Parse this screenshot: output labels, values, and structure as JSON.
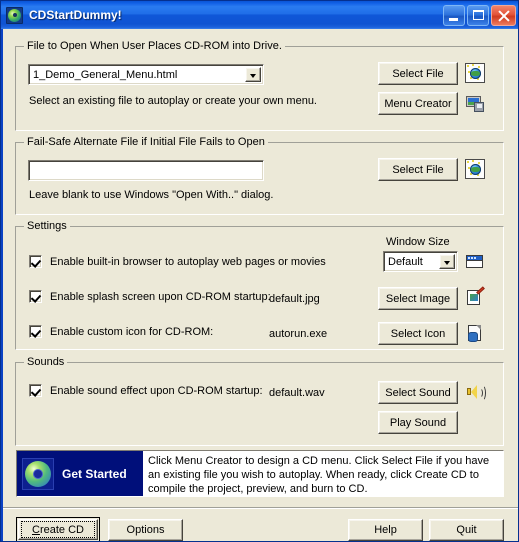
{
  "window": {
    "title": "CDStartDummy!",
    "app_icon": "cd-disc-icon",
    "controls": {
      "minimize": "minimize-button",
      "maximize": "maximize-button",
      "close": "close-button"
    },
    "colors": {
      "titlebar_blue": "#1261e6",
      "client_background": "#ece9d8",
      "close_red": "#e3543a",
      "panel_navy": "#000f7a"
    }
  },
  "file_group": {
    "title": "File to Open When User Places CD-ROM into Drive.",
    "combo_value": "1_Demo_General_Menu.html",
    "hint": "Select an existing file to autoplay or create your own menu.",
    "select_file_button": "Select File",
    "menu_creator_button": "Menu Creator",
    "icon_select_file": "web-page-icon",
    "icon_menu_creator": "menu-creator-icon"
  },
  "failsafe_group": {
    "title": "Fail-Safe Alternate File if Initial File Fails to Open",
    "input_value": "",
    "input_placeholder": "",
    "hint": "Leave blank to use Windows \"Open With..\" dialog.",
    "select_file_button": "Select File",
    "icon_select_file": "web-page-icon"
  },
  "settings_group": {
    "title": "Settings",
    "window_size_label": "Window Size",
    "window_size_value": "Default",
    "icon_window_size": "window-icon",
    "rows": [
      {
        "label": "Enable built-in browser to autoplay web pages or movies",
        "checked": true,
        "value": "",
        "button": "",
        "icon": ""
      },
      {
        "label": "Enable splash screen upon CD-ROM startup:",
        "checked": true,
        "value": "default.jpg",
        "button": "Select Image",
        "icon": "image-edit-icon"
      },
      {
        "label": "Enable custom icon for CD-ROM:",
        "checked": true,
        "value": "autorun.exe",
        "button": "Select Icon",
        "icon": "document-icon"
      }
    ]
  },
  "sounds_group": {
    "title": "Sounds",
    "checkbox_label": "Enable sound effect upon CD-ROM startup:",
    "checked": true,
    "value": "default.wav",
    "select_sound_button": "Select Sound",
    "play_sound_button": "Play Sound",
    "icon_speaker": "speaker-icon"
  },
  "get_started": {
    "label": "Get Started",
    "icon": "cd-disc-icon",
    "text": "Click Menu Creator to design a CD menu. Click Select File if you have an existing file you wish to autoplay. When ready, click Create CD to compile the project, preview, and burn to CD."
  },
  "footer": {
    "create_cd": "Create CD",
    "create_cd_accel": "C",
    "create_cd_rest": "reate CD",
    "options": "Options",
    "help": "Help",
    "quit": "Quit"
  }
}
